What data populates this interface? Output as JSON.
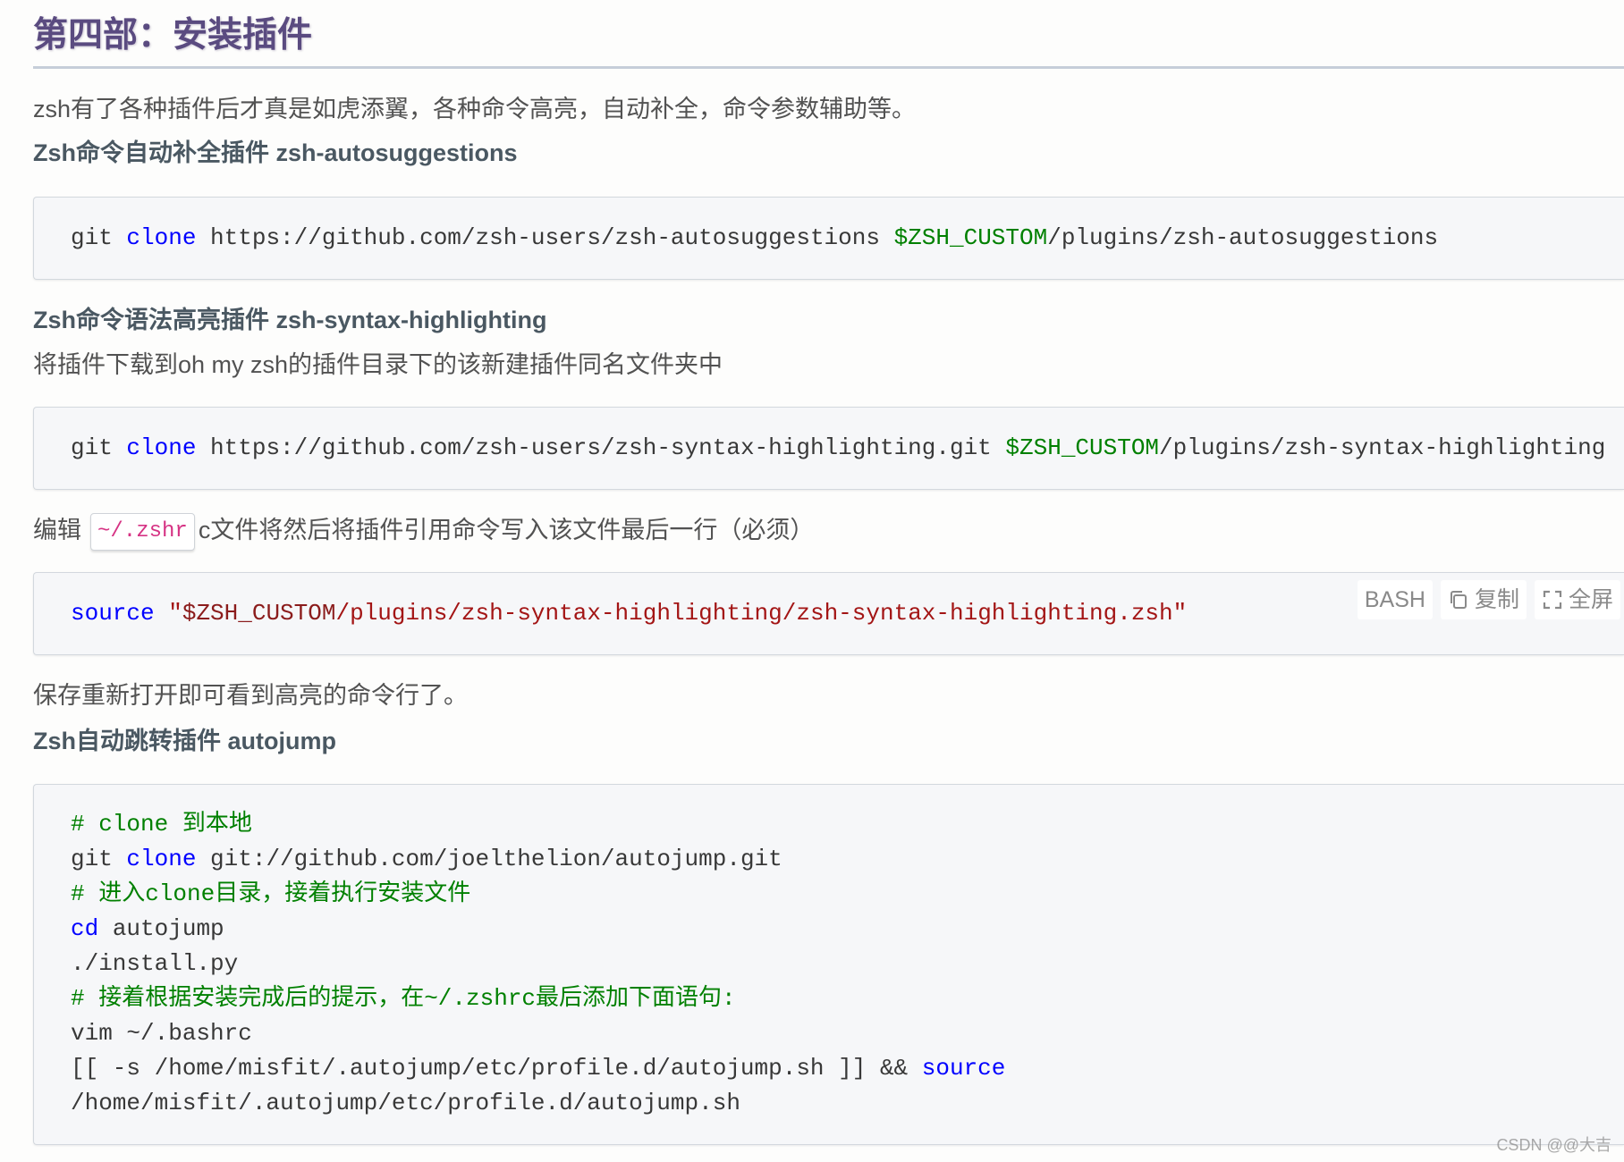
{
  "section": {
    "title": "第四部：安装插件",
    "intro": "zsh有了各种插件后才真是如虎添翼，各种命令高亮，自动补全，命令参数辅助等。"
  },
  "autosuggestions": {
    "heading": "Zsh命令自动补全插件 zsh-autosuggestions",
    "code": {
      "command": "git",
      "keyword": "clone",
      "repo_url": "https://github.com/zsh-users/zsh-autosuggestions",
      "variable": "$ZSH_CUSTOM",
      "target_path": "/plugins/zsh-autosuggestions"
    }
  },
  "syntax_highlighting": {
    "heading": "Zsh命令语法高亮插件 zsh-syntax-highlighting",
    "description": "将插件下载到oh my zsh的插件目录下的该新建插件同名文件夹中",
    "code": {
      "command": "git",
      "keyword": "clone",
      "repo_url": "https://github.com/zsh-users/zsh-syntax-highlighting.git",
      "variable": "$ZSH_CUSTOM",
      "target_path": "/plugins/zsh-syntax-highlighting"
    },
    "edit_note": {
      "before": "编辑",
      "inline_code": "~/.zshr",
      "after": "c文件将然后将插件引用命令写入该文件最后一行（必须）"
    },
    "source_code": {
      "keyword": "source",
      "quote": "\"",
      "variable": "$ZSH_CUSTOM",
      "path": "/plugins/zsh-syntax-highlighting/zsh-syntax-highlighting.zsh\""
    },
    "toolbar": {
      "language": "BASH",
      "copy_label": "复制",
      "fullscreen_label": "全屏",
      "copy_icon": "copy-icon",
      "fullscreen_icon": "fullscreen-icon"
    },
    "after_note": "保存重新打开即可看到高亮的命令行了。"
  },
  "autojump": {
    "heading": "Zsh自动跳转插件 autojump",
    "code_lines": [
      {
        "comment": "# clone 到本地"
      },
      {
        "command": "git",
        "keyword": "clone",
        "args": "git://github.com/joelthelion/autojump.git"
      },
      {
        "comment": "# 进入clone目录，接着执行安装文件"
      },
      {
        "keyword": "cd",
        "args": "autojump"
      },
      {
        "command": "./install.py"
      },
      {
        "comment": "# 接着根据安装完成后的提示，在~/.zshrc最后添加下面语句:"
      },
      {
        "command": "vim",
        "args": "~/.bashrc"
      },
      {
        "expr": "[[ -s /home/misfit/.autojump/etc/profile.d/autojump.sh ]] &&",
        "keyword": "source"
      },
      {
        "args": "/home/misfit/.autojump/etc/profile.d/autojump.sh"
      }
    ]
  },
  "watermark": "CSDN @@大吉",
  "colors": {
    "title": "#5a4b80",
    "keyword": "#0000ff",
    "variable": "#008000",
    "comment": "#008000",
    "string": "#a31515",
    "inline_code": "#d63384"
  }
}
